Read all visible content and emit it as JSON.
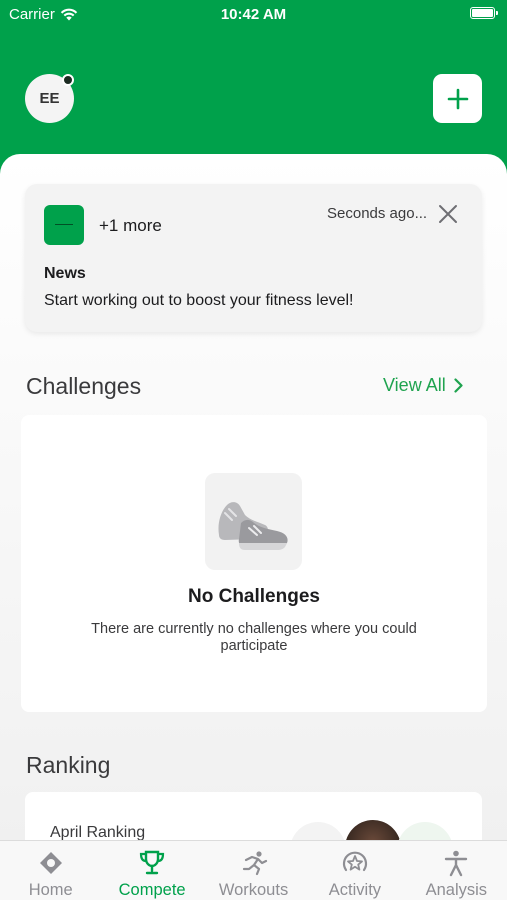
{
  "status_bar": {
    "carrier": "Carrier",
    "time": "10:42 AM",
    "battery_level": 1.0
  },
  "header": {
    "avatar_initials": "EE",
    "add_icon": "plus-icon"
  },
  "notification": {
    "more_count": "+1 more",
    "time": "Seconds ago...",
    "title": "News",
    "body": "Start working out to boost your fitness level!",
    "close_icon": "close-icon"
  },
  "challenges": {
    "title": "Challenges",
    "view_all": "View All",
    "empty_title": "No Challenges",
    "empty_text": "There are currently no challenges where you could participate"
  },
  "ranking": {
    "title": "Ranking",
    "card_label": "April Ranking"
  },
  "tabs": [
    {
      "label": "Home",
      "icon": "home-icon",
      "active": false
    },
    {
      "label": "Compete",
      "icon": "trophy-icon",
      "active": true
    },
    {
      "label": "Workouts",
      "icon": "workout-runner-icon",
      "active": false
    },
    {
      "label": "Activity",
      "icon": "activity-star-icon",
      "active": false
    },
    {
      "label": "Analysis",
      "icon": "person-icon",
      "active": false
    }
  ],
  "colors": {
    "brand": "#00a14b",
    "link": "#1fa34f",
    "inactive": "#8e8e93"
  }
}
